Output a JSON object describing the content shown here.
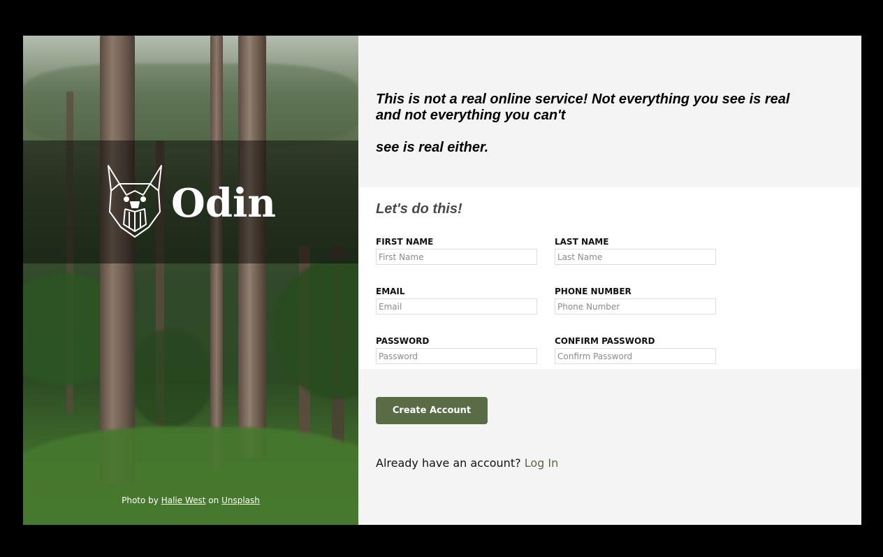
{
  "brand": {
    "name": "Odin"
  },
  "photo_credit": {
    "prefix": "Photo by",
    "author": "Halie West",
    "middle": "on",
    "source": "Unsplash"
  },
  "intro": {
    "line1": "This is not a real online service! Not everything you see is real and not everything you can't",
    "line2": "see is real either."
  },
  "form": {
    "heading": "Let's do this!",
    "fields": [
      {
        "label": "FIRST NAME",
        "placeholder": "First Name",
        "value": ""
      },
      {
        "label": "LAST NAME",
        "placeholder": "Last Name",
        "value": ""
      },
      {
        "label": "EMAIL",
        "placeholder": "Email",
        "value": ""
      },
      {
        "label": "PHONE NUMBER",
        "placeholder": "Phone Number",
        "value": ""
      },
      {
        "label": "PASSWORD",
        "placeholder": "Password",
        "value": ""
      },
      {
        "label": "CONFIRM PASSWORD",
        "placeholder": "Confirm Password",
        "value": ""
      }
    ]
  },
  "actions": {
    "create_label": "Create Account",
    "login_prompt": "Already have an account?",
    "login_link": "Log In"
  },
  "colors": {
    "accent": "#596c45",
    "panel_bg": "#f4f4f4",
    "form_bg": "#ffffff"
  },
  "icons": {
    "logo": "viking-dog-logo-icon"
  }
}
